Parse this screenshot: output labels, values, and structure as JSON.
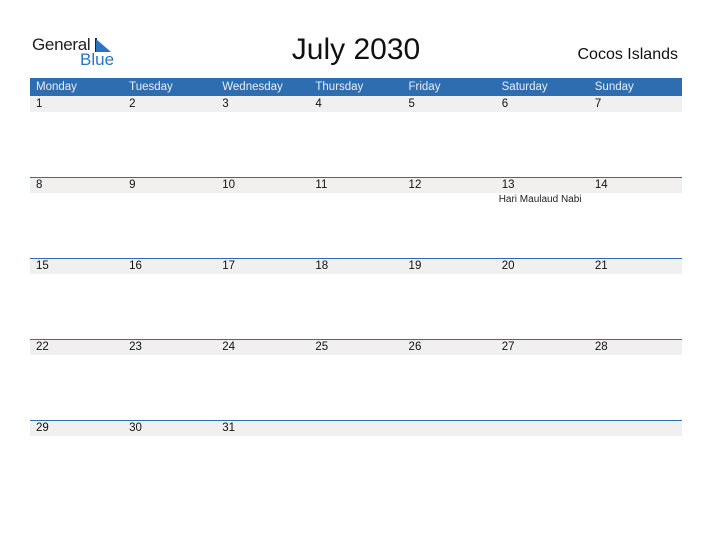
{
  "logo": {
    "line1": "General",
    "line2": "Blue"
  },
  "title": "July 2030",
  "country": "Cocos Islands",
  "colors": {
    "header_bg": "#2e6eb0",
    "accent": "#2a74c0",
    "day_strip": "#f0f0f0"
  },
  "weekdays": [
    "Monday",
    "Tuesday",
    "Wednesday",
    "Thursday",
    "Friday",
    "Saturday",
    "Sunday"
  ],
  "weeks": [
    [
      {
        "day": "1"
      },
      {
        "day": "2"
      },
      {
        "day": "3"
      },
      {
        "day": "4"
      },
      {
        "day": "5"
      },
      {
        "day": "6"
      },
      {
        "day": "7"
      }
    ],
    [
      {
        "day": "8"
      },
      {
        "day": "9"
      },
      {
        "day": "10"
      },
      {
        "day": "11"
      },
      {
        "day": "12"
      },
      {
        "day": "13",
        "event": "Hari Maulaud Nabi"
      },
      {
        "day": "14"
      }
    ],
    [
      {
        "day": "15"
      },
      {
        "day": "16"
      },
      {
        "day": "17"
      },
      {
        "day": "18"
      },
      {
        "day": "19"
      },
      {
        "day": "20"
      },
      {
        "day": "21"
      }
    ],
    [
      {
        "day": "22"
      },
      {
        "day": "23"
      },
      {
        "day": "24"
      },
      {
        "day": "25"
      },
      {
        "day": "26"
      },
      {
        "day": "27"
      },
      {
        "day": "28"
      }
    ],
    [
      {
        "day": "29"
      },
      {
        "day": "30"
      },
      {
        "day": "31"
      },
      {
        "day": ""
      },
      {
        "day": ""
      },
      {
        "day": ""
      },
      {
        "day": ""
      }
    ]
  ]
}
